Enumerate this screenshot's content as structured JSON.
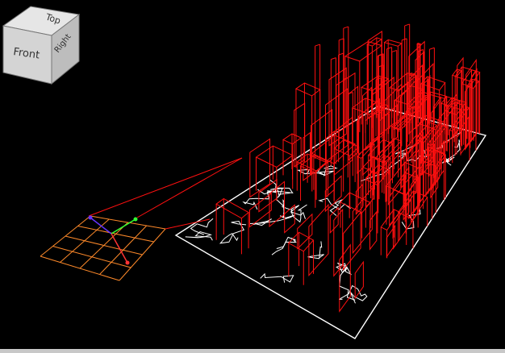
{
  "view_cube": {
    "top_label": "Top",
    "front_label": "Front",
    "right_label": "Right"
  },
  "colors": {
    "background": "#000000",
    "wireframe": "#ff0000",
    "contours": "#ffffff",
    "grid": "#ff8a2a",
    "axis_x": "#ff3333",
    "axis_y": "#33ff33",
    "axis_z": "#6633ff",
    "cube_face": "#d8d8d8"
  }
}
